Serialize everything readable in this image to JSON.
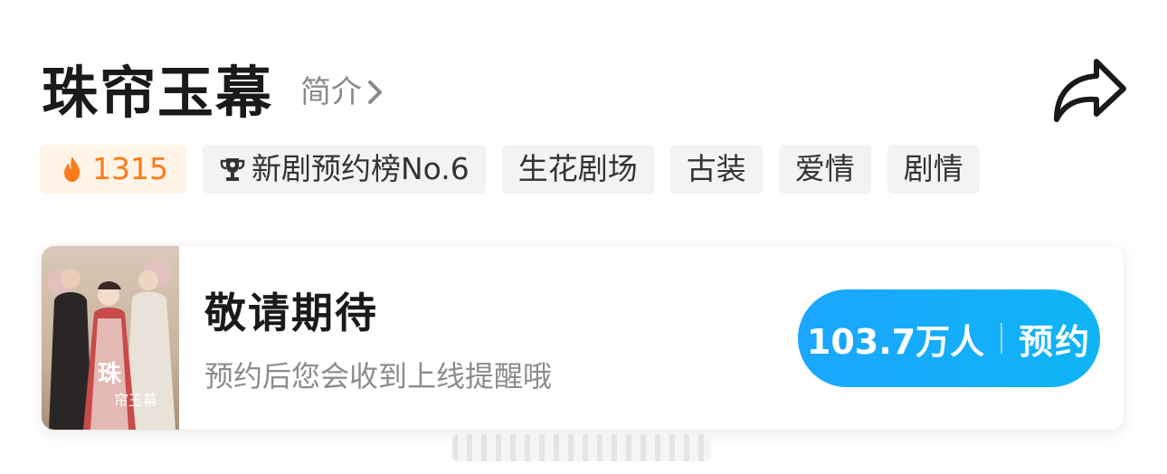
{
  "header": {
    "title": "珠帘玉幕",
    "intro_label": "简介",
    "share_icon": "share-icon"
  },
  "tags": {
    "heat": "1315",
    "rank": "新剧预约榜No.6",
    "studio": "生花剧场",
    "genre1": "古装",
    "genre2": "爱情",
    "genre3": "剧情"
  },
  "card": {
    "title": "敬请期待",
    "subtitle": "预约后您会收到上线提醒哦",
    "reserve_count": "103.7万人",
    "reserve_label": "预约",
    "poster_icon": "drama-poster-image"
  },
  "colors": {
    "accent_blue": "#1ba6ff",
    "heat_orange": "#ff7a1a",
    "heat_bg": "#fff4e5",
    "tag_bg": "#f3f3f3"
  }
}
